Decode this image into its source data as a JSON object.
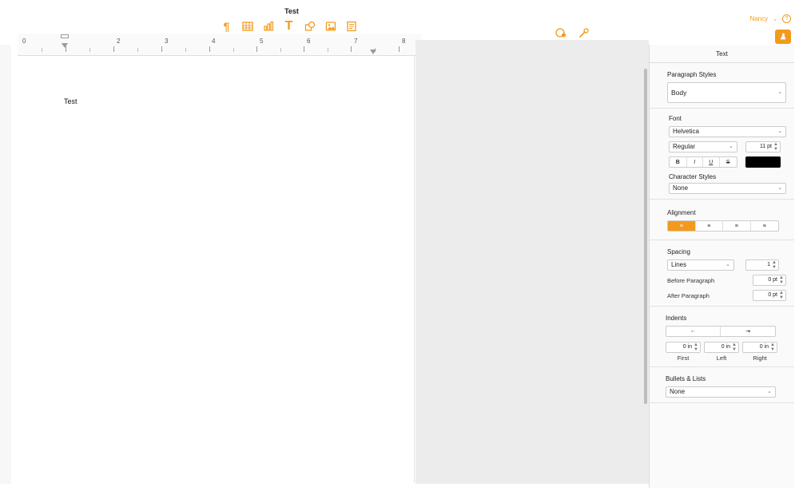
{
  "window": {
    "title": "Test"
  },
  "user": {
    "name": "Nancy",
    "help": "?"
  },
  "toolbar": {
    "items": [
      {
        "name": "paragraph",
        "glyph": "¶"
      },
      {
        "name": "table"
      },
      {
        "name": "chart"
      },
      {
        "name": "text",
        "glyph": "T"
      },
      {
        "name": "shape"
      },
      {
        "name": "media"
      },
      {
        "name": "comment"
      }
    ]
  },
  "ruler": {
    "labels": [
      "0",
      "2",
      "3",
      "4",
      "5",
      "6",
      "7",
      "8"
    ]
  },
  "document": {
    "text": "Test"
  },
  "inspector": {
    "tab": "Text",
    "paragraph_styles": {
      "title": "Paragraph Styles",
      "value": "Body"
    },
    "font": {
      "title": "Font",
      "family": "Helvetica",
      "typeface": "Regular",
      "size": "11 pt",
      "bold": "B",
      "italic": "I",
      "underline": "U",
      "strike": "S",
      "color": "#000000"
    },
    "character_styles": {
      "title": "Character Styles",
      "value": "None"
    },
    "alignment": {
      "title": "Alignment",
      "active_index": 0
    },
    "spacing": {
      "title": "Spacing",
      "mode": "Lines",
      "value": "1",
      "before_label": "Before Paragraph",
      "before_value": "0 pt",
      "after_label": "After Paragraph",
      "after_value": "0 pt"
    },
    "indents": {
      "title": "Indents",
      "first_label": "First",
      "first_value": "0 in",
      "left_label": "Left",
      "left_value": "0 in",
      "right_label": "Right",
      "right_value": "0 in"
    },
    "bullets": {
      "title": "Bullets & Lists",
      "value": "None"
    }
  },
  "colors": {
    "accent": "#f39a1d",
    "canvas_gray": "#ececec"
  }
}
